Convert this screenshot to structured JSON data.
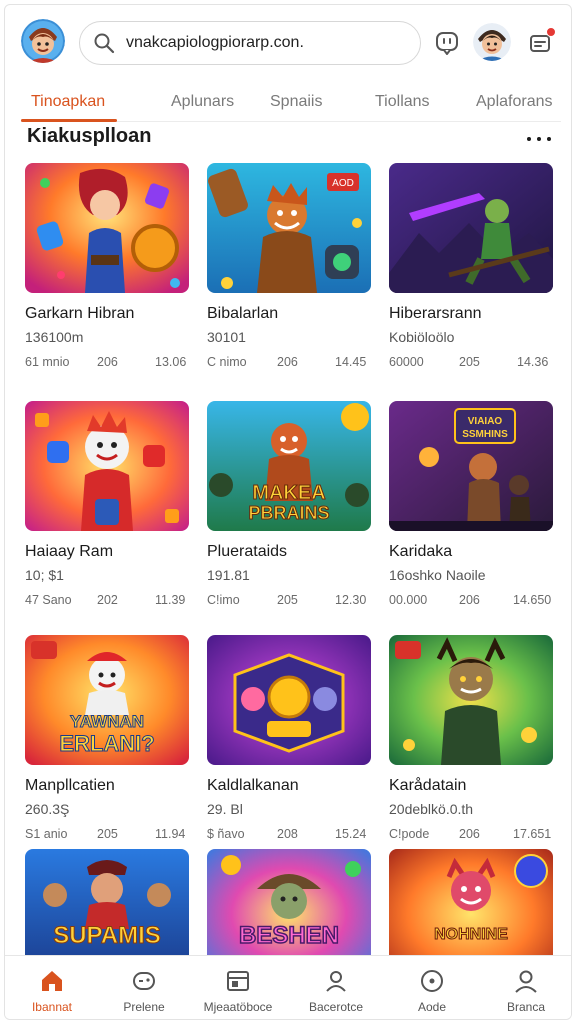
{
  "header": {
    "search": {
      "value": "vnakcapiologpiorarp.con."
    },
    "icons": {
      "search": "magnifier-icon",
      "support": "chat-bubble-icon",
      "user": "avatar",
      "notification": "bell-badge-icon"
    }
  },
  "tabs": [
    {
      "label": "Tinoapkan",
      "active": true
    },
    {
      "label": "Aplunars"
    },
    {
      "label": "Spnaiis"
    },
    {
      "label": "Tiollans"
    },
    {
      "label": "Aplaforans"
    }
  ],
  "section": {
    "title": "Kiakusplloan"
  },
  "cards": [
    {
      "title": "Garkarn Hibran",
      "subtitle": "136100m",
      "meta": [
        "61 mnio",
        "206",
        "13.06"
      ]
    },
    {
      "title": "Bibalarlan",
      "subtitle": "30101",
      "meta": [
        "C nimo",
        "206",
        "14.45"
      ]
    },
    {
      "title": "Hiberarsrann",
      "subtitle": "Kobiöloölo",
      "meta": [
        "60000",
        "205",
        "14.36"
      ]
    },
    {
      "title": "Haiaay Ram",
      "subtitle": "10; $1",
      "meta": [
        "47 Sano",
        "202",
        "11.39"
      ]
    },
    {
      "title": "Pluerataids",
      "subtitle": "191.81",
      "meta": [
        "C!imo",
        "205",
        "12.30"
      ]
    },
    {
      "title": "Karidaka",
      "subtitle": "16oshko Naoile",
      "meta": [
        "00.000",
        "206",
        "14.650"
      ]
    },
    {
      "title": "Manpllcatien",
      "subtitle": "260.3Ş",
      "meta": [
        "S1 anio",
        "205",
        "11.94"
      ]
    },
    {
      "title": "Kaldlalkanan",
      "subtitle": "29. Bl",
      "meta": [
        "$ ñavo",
        "208",
        "15.24"
      ]
    },
    {
      "title": "Karådatain",
      "subtitle": "20deblkö.0.th",
      "meta": [
        "C!pode",
        "206",
        "17.651"
      ]
    },
    {
      "title": "",
      "subtitle": "",
      "meta": [
        "",
        "",
        ""
      ]
    },
    {
      "title": "",
      "subtitle": "",
      "meta": [
        "",
        "",
        ""
      ]
    },
    {
      "title": "",
      "subtitle": "",
      "meta": [
        "",
        "",
        ""
      ]
    }
  ],
  "thumb_text": {
    "card5": [
      "MAKEA",
      "PBRAINS"
    ],
    "card6": [
      "VIAIAO",
      "SSMHINS"
    ],
    "card7": [
      "YAWNAN",
      "ERLANI?"
    ],
    "card10": "SUPAMIS",
    "card11": "BESHEN",
    "card12": "NOHNINE",
    "card2_sign": "AOD"
  },
  "bottom_nav": [
    {
      "label": "Ibannat",
      "icon": "home-icon",
      "active": true
    },
    {
      "label": "Prelene",
      "icon": "game-controller-icon"
    },
    {
      "label": "Mjeaatöboce",
      "icon": "store-icon"
    },
    {
      "label": "Bacerotce",
      "icon": "person-icon"
    },
    {
      "label": "Aode",
      "icon": "compass-icon"
    },
    {
      "label": "Branca",
      "icon": "profile-icon"
    }
  ],
  "colors": {
    "accent": "#d9531e",
    "text": "#1b1b1b",
    "muted": "#6a6a6a",
    "border": "#e3e3e3"
  }
}
